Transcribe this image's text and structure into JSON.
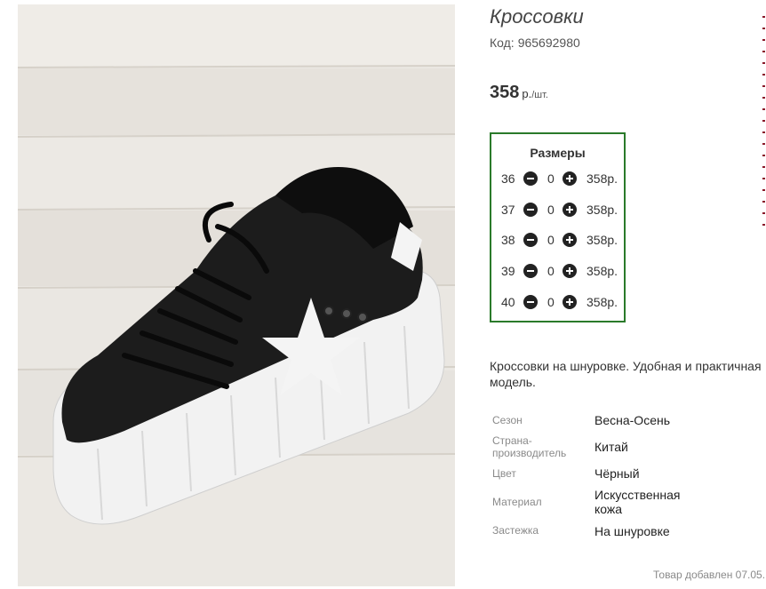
{
  "product": {
    "title": "Кроссовки",
    "code_label": "Код:",
    "code_value": "965692980",
    "price_value": "358",
    "price_currency": "р.",
    "price_unit": "/шт."
  },
  "sizes": {
    "title": "Размеры",
    "rows": [
      {
        "size": "36",
        "qty": "0",
        "price": "358р."
      },
      {
        "size": "37",
        "qty": "0",
        "price": "358р."
      },
      {
        "size": "38",
        "qty": "0",
        "price": "358р."
      },
      {
        "size": "39",
        "qty": "0",
        "price": "358р."
      },
      {
        "size": "40",
        "qty": "0",
        "price": "358р."
      }
    ]
  },
  "description": "Кроссовки на шнуровке. Удобная и практичная модель.",
  "attributes": [
    {
      "name": "Сезон",
      "value": "Весна-Осень"
    },
    {
      "name": "Страна-производитель",
      "value": "Китай"
    },
    {
      "name": "Цвет",
      "value": "Чёрный"
    },
    {
      "name": "Материал",
      "value": "Искусственная кожа"
    },
    {
      "name": "Застежка",
      "value": "На шнуровке"
    }
  ],
  "added_text": "Товар добавлен 07.05.",
  "colors": {
    "sizes_border": "#2a7a2a",
    "button_dark": "#222222",
    "shoe_black": "#1c1c1c",
    "sole_white": "#f2f2f2"
  },
  "icons": {
    "minus": "minus-circle-icon",
    "plus": "plus-circle-icon"
  }
}
